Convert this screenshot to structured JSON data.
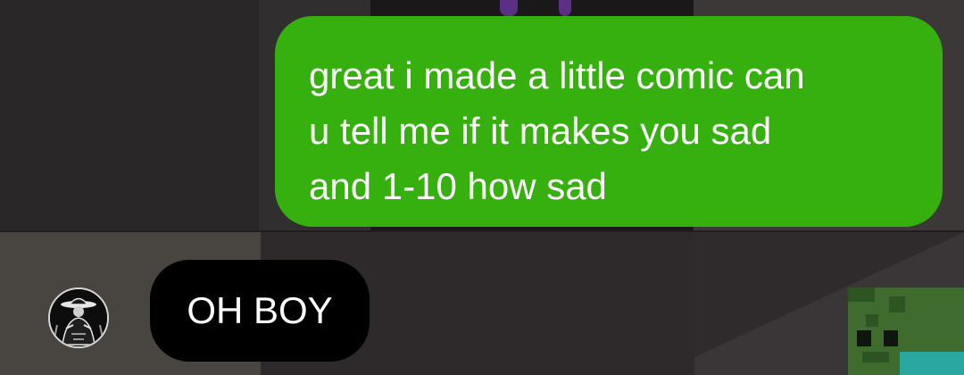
{
  "conversation": {
    "messages": [
      {
        "direction": "outgoing",
        "lines": [
          "great i made a little comic can",
          "u tell me if it makes you sad",
          "and 1-10 how sad"
        ]
      },
      {
        "direction": "incoming",
        "text": "OH BOY",
        "avatar": "profile-avatar-icon"
      }
    ]
  },
  "colors": {
    "outgoing_bubble": "#36b00e",
    "incoming_bubble": "#000000",
    "text": "#ffffff"
  }
}
